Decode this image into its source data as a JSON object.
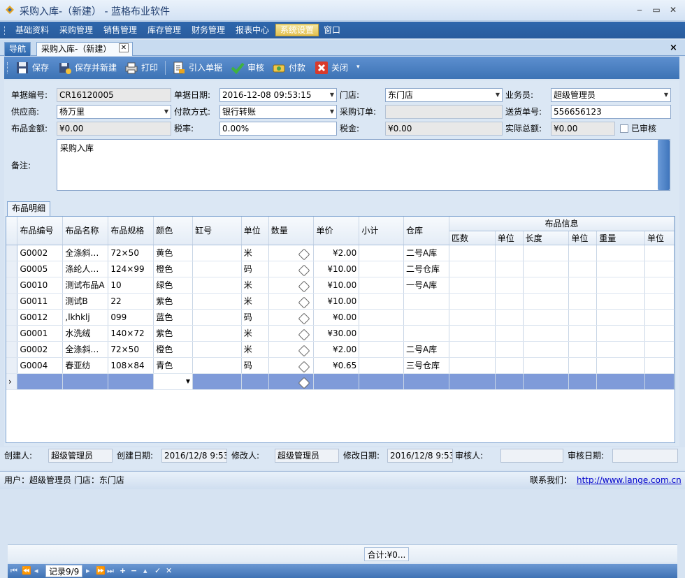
{
  "window": {
    "title": "采购入库-（新建） - 蓝格布业软件",
    "minimize": "‒",
    "restore": "▭",
    "close": "✕"
  },
  "menu": [
    "基础资料",
    "采购管理",
    "销售管理",
    "库存管理",
    "财务管理",
    "报表中心",
    "系统设置",
    "窗口"
  ],
  "menu_active": "系统设置",
  "tabs": {
    "nav": "导航",
    "doc": "采购入库-（新建）",
    "doc_close": "✕",
    "panel_close": "×"
  },
  "toolbar": {
    "save": "保存",
    "save_new": "保存并新建",
    "print": "打印",
    "import": "引入单据",
    "audit": "审核",
    "pay": "付款",
    "close": "关闭"
  },
  "form": {
    "doc_no_label": "单据编号:",
    "doc_no": "CR16120005",
    "doc_date_label": "单据日期:",
    "doc_date": "2016-12-08 09:53:15",
    "store_label": "门店:",
    "store": "东门店",
    "clerk_label": "业务员:",
    "clerk": "超级管理员",
    "supplier_label": "供应商:",
    "supplier": "杨万里",
    "pay_method_label": "付款方式:",
    "pay_method": "银行转账",
    "purchase_order_label": "采购订单:",
    "purchase_order": "",
    "delivery_no_label": "送货单号:",
    "delivery_no": "556656123",
    "amount_label": "布品金额:",
    "amount": "¥0.00",
    "tax_rate_label": "税率:",
    "tax_rate": "0.00%",
    "tax_label": "税金:",
    "tax": "¥0.00",
    "total_label": "实际总额:",
    "total": "¥0.00",
    "audited_label": "已审核",
    "remark_label": "备注:",
    "remark": "采购入库"
  },
  "grid": {
    "tab_label": "布品明细",
    "group_header": "布品信息",
    "columns": [
      "布品编号",
      "布品名称",
      "布品规格",
      "颜色",
      "缸号",
      "单位",
      "数量",
      "单价",
      "小计",
      "仓库"
    ],
    "sub_columns": [
      "匹数",
      "单位",
      "长度",
      "单位",
      "重量",
      "单位"
    ],
    "rows": [
      {
        "code": "G0002",
        "name": "全涤斜…",
        "spec": "72×50",
        "color": "黄色",
        "unit": "米",
        "price": "¥2.00",
        "warehouse": "二号A库"
      },
      {
        "code": "G0005",
        "name": "涤纶人…",
        "spec": "124×99",
        "color": "橙色",
        "unit": "码",
        "price": "¥10.00",
        "warehouse": "二号仓库"
      },
      {
        "code": "G0010",
        "name": "测试布品A",
        "spec": "10",
        "color": "绿色",
        "unit": "米",
        "price": "¥10.00",
        "warehouse": "一号A库"
      },
      {
        "code": "G0011",
        "name": "测试B",
        "spec": "22",
        "color": "紫色",
        "unit": "米",
        "price": "¥10.00",
        "warehouse": ""
      },
      {
        "code": "G0012",
        "name": ",lkhklj",
        "spec": "099",
        "color": "蓝色",
        "unit": "码",
        "price": "¥0.00",
        "warehouse": ""
      },
      {
        "code": "G0001",
        "name": "水洗绒",
        "spec": "140×72",
        "color": "紫色",
        "unit": "米",
        "price": "¥30.00",
        "warehouse": ""
      },
      {
        "code": "G0002",
        "name": "全涤斜…",
        "spec": "72×50",
        "color": "橙色",
        "unit": "米",
        "price": "¥2.00",
        "warehouse": "二号A库"
      },
      {
        "code": "G0004",
        "name": "春亚纺",
        "spec": "108×84",
        "color": "青色",
        "unit": "码",
        "price": "¥0.65",
        "warehouse": "三号仓库"
      }
    ],
    "new_row_marker": "›",
    "total": "合计:¥0..."
  },
  "pager": {
    "first": "⏮",
    "prev_page": "⏪",
    "prev": "◂",
    "record": "记录9/9",
    "next": "▸",
    "next_page": "⏩",
    "last": "⏭",
    "add": "+",
    "remove": "−",
    "up": "▴",
    "confirm": "✓",
    "cancel": "✕"
  },
  "footer": {
    "creator_label": "创建人:",
    "creator": "超级管理员",
    "created_label": "创建日期:",
    "created": "2016/12/8 9:53",
    "modifier_label": "修改人:",
    "modifier": "超级管理员",
    "modified_label": "修改日期:",
    "modified": "2016/12/8 9:53",
    "auditor_label": "审核人:",
    "auditor": "",
    "audit_date_label": "审核日期:",
    "audit_date": ""
  },
  "status": {
    "user": "用户：超级管理员  门店：东门店",
    "contact_label": "联系我们：",
    "link": "http://www.lange.com.cn"
  },
  "colors": {
    "menubar": "#2e67ad",
    "toolbar": "#3d73b5",
    "selected_row": "#7f9bd9",
    "accent_tab": "#e3c04f"
  }
}
